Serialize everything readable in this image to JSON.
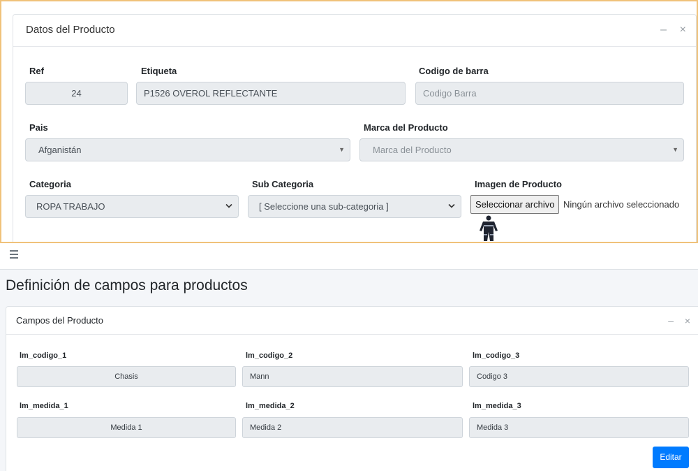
{
  "product_card": {
    "title": "Datos del Producto",
    "minimize_icon": "minus-icon",
    "close_icon": "close-icon",
    "ref": {
      "label": "Ref",
      "value": "24"
    },
    "etiqueta": {
      "label": "Etiqueta",
      "value": "P1526 OVEROL REFLECTANTE"
    },
    "barcode": {
      "label": "Codigo de barra",
      "placeholder": "Codigo Barra"
    },
    "pais": {
      "label": "Pais",
      "value": "Afganistán"
    },
    "marca": {
      "label": "Marca del Producto",
      "placeholder": "Marca del Producto"
    },
    "categoria": {
      "label": "Categoria",
      "value": "ROPA TRABAJO"
    },
    "subcategoria": {
      "label": "Sub Categoria",
      "value": "[ Seleccione una sub-categoria ]"
    },
    "imagen": {
      "label": "Imagen de Producto",
      "button": "Seleccionar archivo",
      "status": "Ningún archivo seleccionado"
    }
  },
  "navbar": {
    "menu_icon": "hamburger-icon"
  },
  "page": {
    "title": "Definición de campos para productos"
  },
  "fields_card": {
    "title": "Campos del Producto",
    "fields": [
      {
        "label": "lm_codigo_1",
        "value": "Chasis"
      },
      {
        "label": "lm_codigo_2",
        "value": "Mann"
      },
      {
        "label": "lm_codigo_3",
        "value": "Codigo 3"
      },
      {
        "label": "lm_medida_1",
        "value": "Medida 1"
      },
      {
        "label": "lm_medida_2",
        "value": "Medida 2"
      },
      {
        "label": "lm_medida_3",
        "value": "Medida 3"
      }
    ],
    "edit_button": "Editar"
  },
  "colors": {
    "accent": "#007bff",
    "highlight_border": "#f0c27a",
    "field_bg": "#e9ecef"
  }
}
